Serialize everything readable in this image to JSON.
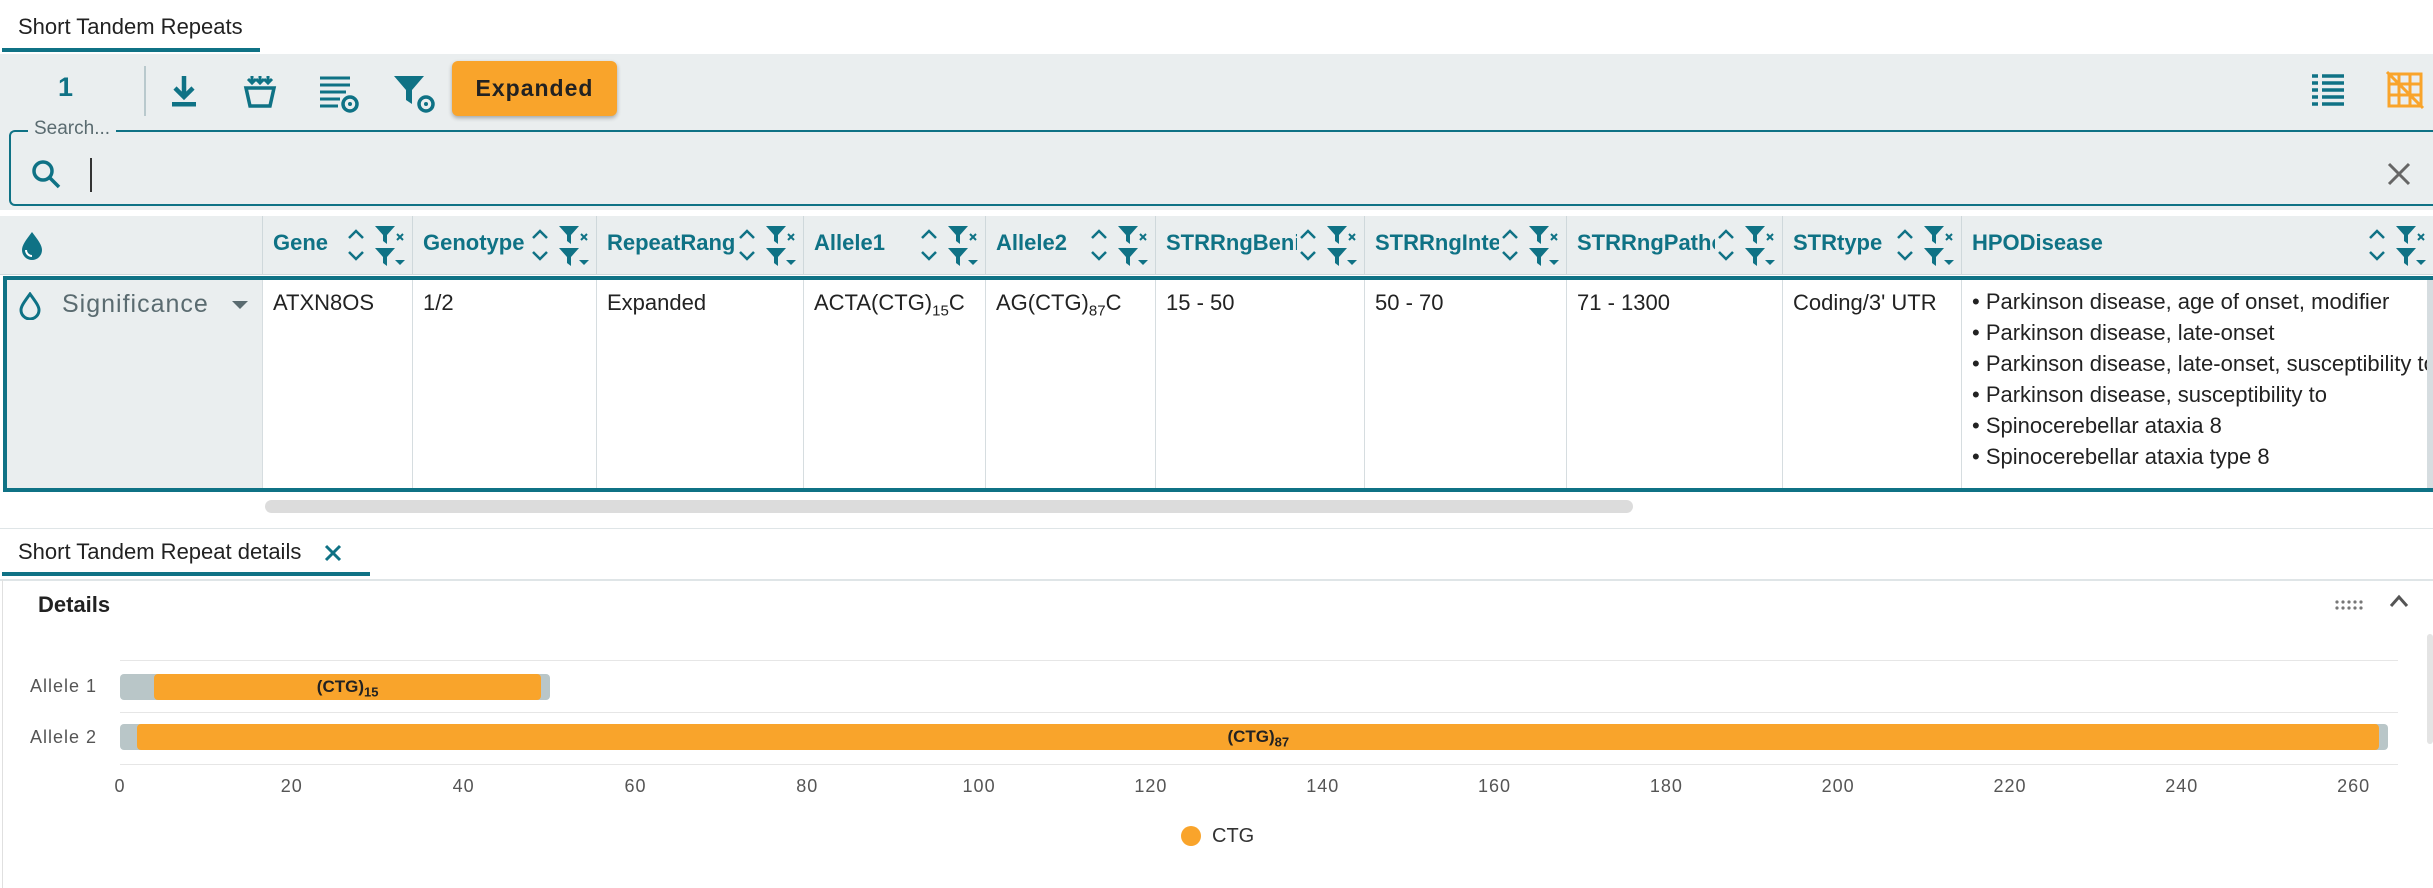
{
  "tab": {
    "label": "Short Tandem Repeats"
  },
  "toolbar": {
    "count": "1",
    "expanded_label": "Expanded",
    "icons": [
      "download-icon",
      "basket-icon",
      "column-settings-icon",
      "filter-settings-icon",
      "list-view-icon",
      "grid-off-icon"
    ]
  },
  "search": {
    "label": "Search...",
    "value": ""
  },
  "grid": {
    "columns": [
      "Gene",
      "Genotype",
      "RepeatRange…",
      "Allele1",
      "Allele2",
      "STRRngBenign",
      "STRRngInter…",
      "STRRngPatho",
      "STRtype",
      "HPODisease"
    ],
    "group": {
      "label": "Significance"
    },
    "row": {
      "gene": "ATXN8OS",
      "genotype": "1/2",
      "repeat_range": "Expanded",
      "allele1_prefix": "ACTA(CTG)",
      "allele1_sub": "15",
      "allele1_suffix": "C",
      "allele2_prefix": "AG(CTG)",
      "allele2_sub": "87",
      "allele2_suffix": "C",
      "benign": "15 - 50",
      "intermediate": "50 - 70",
      "pathogenic": "71 - 1300",
      "strtype": "Coding/3' UTR",
      "hpo": [
        "• Parkinson disease, age of onset, modifier",
        "• Parkinson disease, late-onset",
        "• Parkinson disease, late-onset, susceptibility to",
        "• Parkinson disease, susceptibility to",
        "• Spinocerebellar ataxia 8",
        "• Spinocerebellar ataxia type 8"
      ]
    }
  },
  "details_tab": {
    "label": "Short Tandem Repeat details"
  },
  "details": {
    "title": "Details"
  },
  "colors": {
    "accent": "#0f7285",
    "repeat": "#f9a42b",
    "flank": "#b9c6c8"
  },
  "chart_data": {
    "type": "bar",
    "orientation": "horizontal",
    "categories": [
      "Allele 1",
      "Allele 2"
    ],
    "series": [
      {
        "name": "CTG",
        "segments": [
          {
            "allele": "Allele 1",
            "start": 4,
            "end": 49,
            "label": "(CTG)",
            "label_sub": "15"
          },
          {
            "allele": "Allele 2",
            "start": 2,
            "end": 263,
            "label": "(CTG)",
            "label_sub": "87"
          }
        ]
      }
    ],
    "flanks": [
      {
        "allele": "Allele 1",
        "start": 0,
        "end": 50
      },
      {
        "allele": "Allele 2",
        "start": 0,
        "end": 264
      }
    ],
    "xticks": [
      "0",
      "20",
      "40",
      "60",
      "80",
      "100",
      "120",
      "140",
      "160",
      "180",
      "200",
      "220",
      "240",
      "260"
    ],
    "xlim": [
      0,
      264
    ],
    "legend": [
      "CTG"
    ],
    "legend_position": "bottom"
  }
}
